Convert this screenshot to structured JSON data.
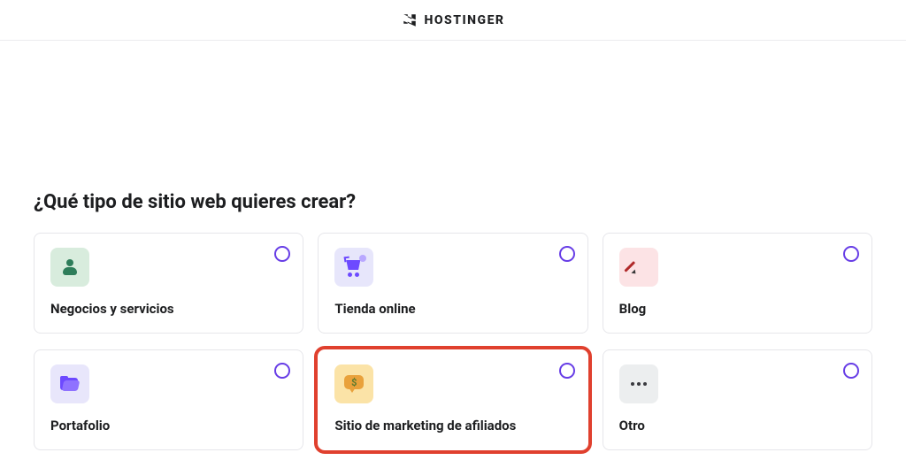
{
  "header": {
    "brand": "HOSTINGER"
  },
  "question": "¿Qué tipo de sitio web quieres crear?",
  "options": [
    {
      "id": "business",
      "label": "Negocios y servicios",
      "icon": "person-icon",
      "color": "green",
      "highlighted": false
    },
    {
      "id": "store",
      "label": "Tienda online",
      "icon": "cart-icon",
      "color": "purple",
      "highlighted": false
    },
    {
      "id": "blog",
      "label": "Blog",
      "icon": "pencil-icon",
      "color": "pink",
      "highlighted": false
    },
    {
      "id": "portfolio",
      "label": "Portafolio",
      "icon": "folder-icon",
      "color": "lilac",
      "highlighted": false
    },
    {
      "id": "affiliate",
      "label": "Sitio de marketing de afiliados",
      "icon": "chat-dollar-icon",
      "color": "amber",
      "highlighted": true
    },
    {
      "id": "other",
      "label": "Otro",
      "icon": "dots-icon",
      "color": "gray",
      "highlighted": false
    }
  ],
  "colors": {
    "accent": "#673de6",
    "highlight": "#e0402e"
  }
}
